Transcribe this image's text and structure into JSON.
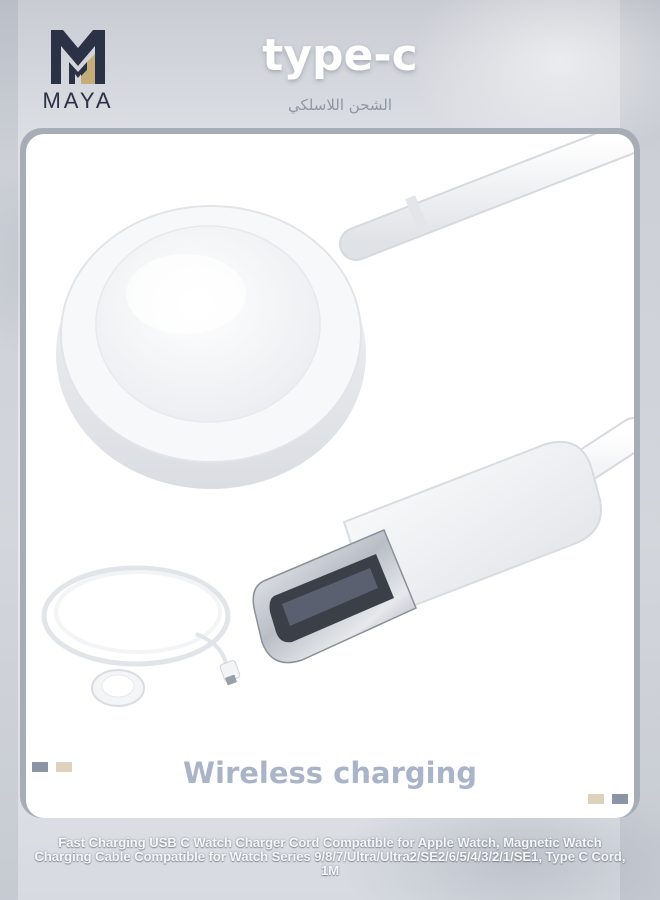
{
  "brand": {
    "name": "MAYA",
    "logo_icon": "maya-m-logo-icon"
  },
  "header": {
    "title": "type-c",
    "subtitle": "الشحن اللاسلكي"
  },
  "product_image": {
    "main": "watch-charger-puck-with-usb-c-plug",
    "inset": "full-cable-with-charger-and-plug"
  },
  "caption": "Wireless charging",
  "footer_text": "Fast Charging USB C Watch Charger Cord Compatible for Apple Watch, Magnetic Watch Charging Cable Compatible for Watch Series 9/8/7/Ultra/Ultra2/SE2/6/5/4/3/2/1/SE1, Type C Cord, 1M",
  "colors": {
    "logo_dark": "#2c3245",
    "logo_gold": "#c5ad7a",
    "caption": "#a9b4c8",
    "swatch_slate": "#8c95a5",
    "swatch_beige": "#ddd3bc"
  }
}
